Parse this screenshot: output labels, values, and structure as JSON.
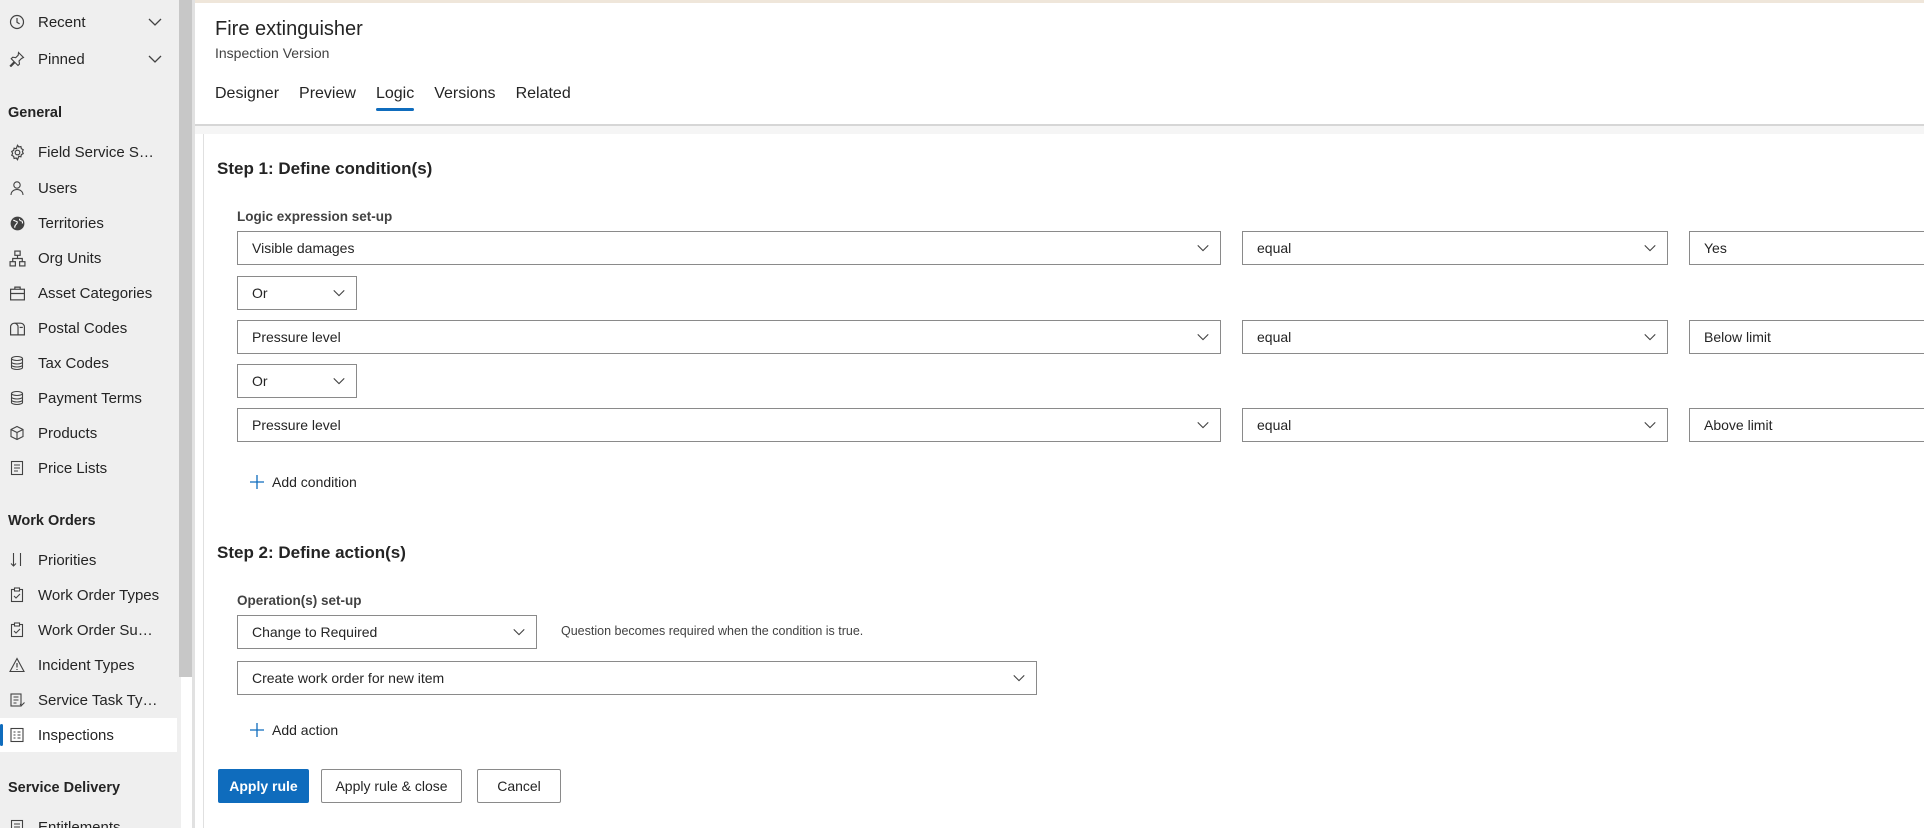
{
  "sidebar": {
    "recent_label": "Recent",
    "pinned_label": "Pinned",
    "sections": {
      "general": "General",
      "work_orders": "Work Orders",
      "service_delivery": "Service Delivery"
    },
    "general_items": [
      {
        "label": "Field Service Setti...",
        "icon": "gear-icon"
      },
      {
        "label": "Users",
        "icon": "person-icon"
      },
      {
        "label": "Territories",
        "icon": "globe-icon"
      },
      {
        "label": "Org Units",
        "icon": "org-chart-icon"
      },
      {
        "label": "Asset Categories",
        "icon": "briefcase-icon"
      },
      {
        "label": "Postal Codes",
        "icon": "mailbox-icon"
      },
      {
        "label": "Tax Codes",
        "icon": "database-icon"
      },
      {
        "label": "Payment Terms",
        "icon": "database-icon"
      },
      {
        "label": "Products",
        "icon": "box-icon"
      },
      {
        "label": "Price Lists",
        "icon": "document-icon"
      }
    ],
    "work_order_items": [
      {
        "label": "Priorities",
        "icon": "sort-icon"
      },
      {
        "label": "Work Order Types",
        "icon": "clipboard-icon"
      },
      {
        "label": "Work Order Subst...",
        "icon": "clipboard-icon"
      },
      {
        "label": "Incident Types",
        "icon": "warning-icon"
      },
      {
        "label": "Service Task Types",
        "icon": "task-list-icon"
      },
      {
        "label": "Inspections",
        "icon": "inspection-icon",
        "active": true
      }
    ],
    "service_delivery_items": [
      {
        "label": "Entitlements",
        "icon": "document-icon"
      }
    ]
  },
  "header": {
    "title": "Fire extinguisher",
    "subtitle": "Inspection Version",
    "tabs": [
      {
        "label": "Designer"
      },
      {
        "label": "Preview"
      },
      {
        "label": "Logic",
        "active": true
      },
      {
        "label": "Versions"
      },
      {
        "label": "Related"
      }
    ]
  },
  "step1": {
    "title": "Step 1: Define condition(s)",
    "section_label": "Logic expression set-up",
    "conditions": [
      {
        "question": "Visible damages",
        "operator": "equal",
        "value": "Yes"
      },
      {
        "question": "Pressure level",
        "operator": "equal",
        "value": "Below limit"
      },
      {
        "question": "Pressure level",
        "operator": "equal",
        "value": "Above limit"
      }
    ],
    "connectors": [
      "Or",
      "Or"
    ],
    "add_condition": "Add condition"
  },
  "step2": {
    "title": "Step 2: Define action(s)",
    "section_label": "Operation(s) set-up",
    "operation": "Change to Required",
    "helper": "Question becomes required when the condition is true.",
    "action": "Create work order for new item",
    "add_action": "Add action"
  },
  "buttons": {
    "apply": "Apply rule",
    "apply_close": "Apply rule & close",
    "cancel": "Cancel"
  },
  "colors": {
    "accent": "#0f6cbd",
    "sidebar_bg": "#efefef"
  }
}
